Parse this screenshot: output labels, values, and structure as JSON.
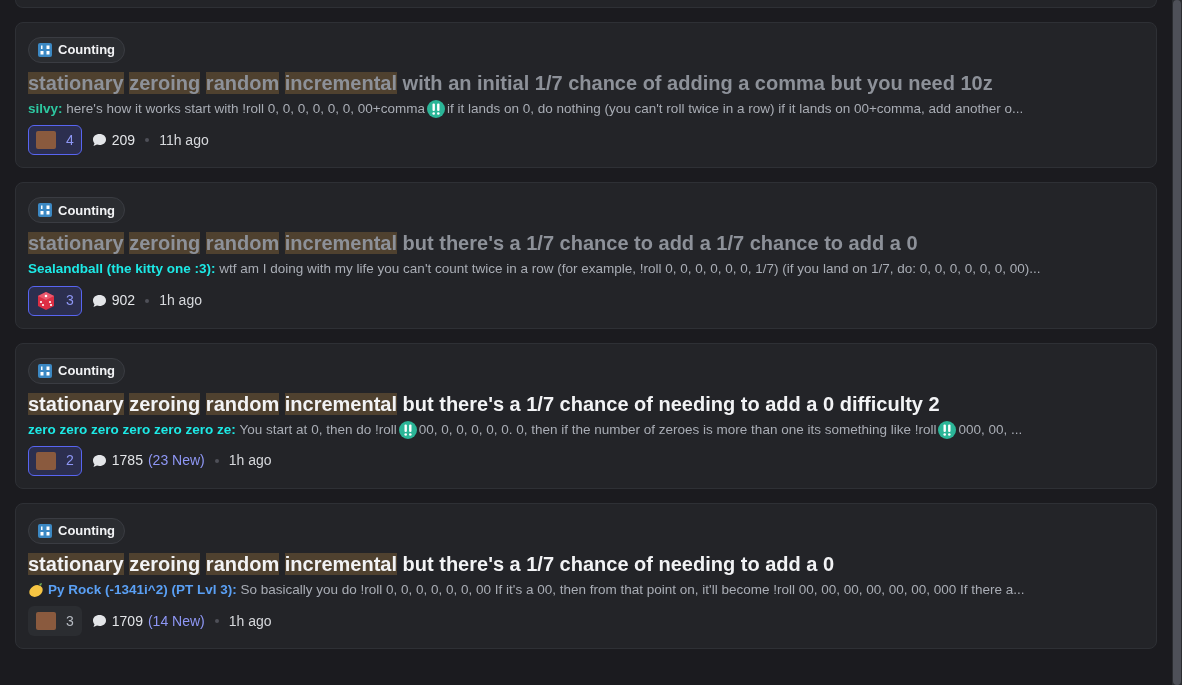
{
  "posts": [
    {
      "tag": {
        "label": "Counting"
      },
      "read": true,
      "title": [
        {
          "text": "stationary",
          "highlight": true
        },
        {
          "text": "zeroing",
          "highlight": true
        },
        {
          "text": "random",
          "highlight": true
        },
        {
          "text": "incremental",
          "highlight": true
        },
        {
          "text": "with an initial 1/7 chance of adding a comma but you need 10z",
          "highlight": false
        }
      ],
      "author": {
        "name": "silvy:",
        "color": "#2dc7a0",
        "lemon_icon": false
      },
      "preview": [
        {
          "kind": "text",
          "text": "here's how it works start with !roll 0, 0, 0, 0, 0, 0, 00+comma"
        },
        {
          "kind": "emoji"
        },
        {
          "kind": "text",
          "text": "if it lands on 0, do nothing (you can't roll twice in a row) if it lands on 00+comma, add another o..."
        }
      ],
      "reaction": {
        "kind": "face",
        "count": "4",
        "selected": true
      },
      "comments": "209",
      "time": "11h ago"
    },
    {
      "tag": {
        "label": "Counting"
      },
      "read": true,
      "title": [
        {
          "text": "stationary",
          "highlight": true
        },
        {
          "text": "zeroing",
          "highlight": true
        },
        {
          "text": "random",
          "highlight": true
        },
        {
          "text": "incremental",
          "highlight": true
        },
        {
          "text": "but there's a 1/7 chance to add a 1/7 chance to add a 0",
          "highlight": false
        }
      ],
      "author": {
        "name": "Sealandball (the kitty one :3):",
        "color": "#1de9e6",
        "lemon_icon": false
      },
      "preview": [
        {
          "kind": "text",
          "text": "wtf am I doing with my life you can't count twice in a row (for example, !roll 0, 0, 0, 0, 0, 0, 1/7) (if you land on 1/7, do: 0, 0, 0, 0, 0, 0, 00)..."
        }
      ],
      "reaction": {
        "kind": "dice",
        "count": "3",
        "selected": true
      },
      "comments": "902",
      "time": "1h ago"
    },
    {
      "tag": {
        "label": "Counting"
      },
      "read": false,
      "title": [
        {
          "text": "stationary",
          "highlight": true
        },
        {
          "text": "zeroing",
          "highlight": true
        },
        {
          "text": "random",
          "highlight": true
        },
        {
          "text": "incremental",
          "highlight": true
        },
        {
          "text": "but there's a 1/7 chance of needing to add a 0 difficulty 2",
          "highlight": false
        }
      ],
      "author": {
        "name": "zero zero zero zero zero zero ze:",
        "color": "#1de9e6",
        "lemon_icon": false
      },
      "preview": [
        {
          "kind": "text",
          "text": "You start at 0, then do !roll"
        },
        {
          "kind": "emoji"
        },
        {
          "kind": "text",
          "text": "00, 0, 0, 0, 0, 0. 0, then if the number of zeroes is more than one its something like !roll"
        },
        {
          "kind": "emoji"
        },
        {
          "kind": "text",
          "text": "000, 00, ..."
        }
      ],
      "reaction": {
        "kind": "face",
        "count": "2",
        "selected": true
      },
      "comments": "1785",
      "new": "(23 New)",
      "time": "1h ago"
    },
    {
      "tag": {
        "label": "Counting"
      },
      "read": false,
      "title": [
        {
          "text": "stationary",
          "highlight": true
        },
        {
          "text": "zeroing",
          "highlight": true
        },
        {
          "text": "random",
          "highlight": true
        },
        {
          "text": "incremental",
          "highlight": true
        },
        {
          "text": "but there's a 1/7 chance of needing to add a 0",
          "highlight": false
        }
      ],
      "author": {
        "name": "Py Rock (-1341i^2) (PT Lvl 3):",
        "color": "#5aa0f5",
        "lemon_icon": true
      },
      "preview": [
        {
          "kind": "text",
          "text": "So basically you do !roll 0, 0, 0, 0, 0, 0, 00 If it's a 00, then from that point on, it'll become !roll 00, 00, 00, 00, 00, 00, 000 If there a..."
        }
      ],
      "reaction": {
        "kind": "face",
        "count": "3",
        "selected": false
      },
      "comments": "1709",
      "new": "(14 New)",
      "time": "1h ago"
    }
  ]
}
